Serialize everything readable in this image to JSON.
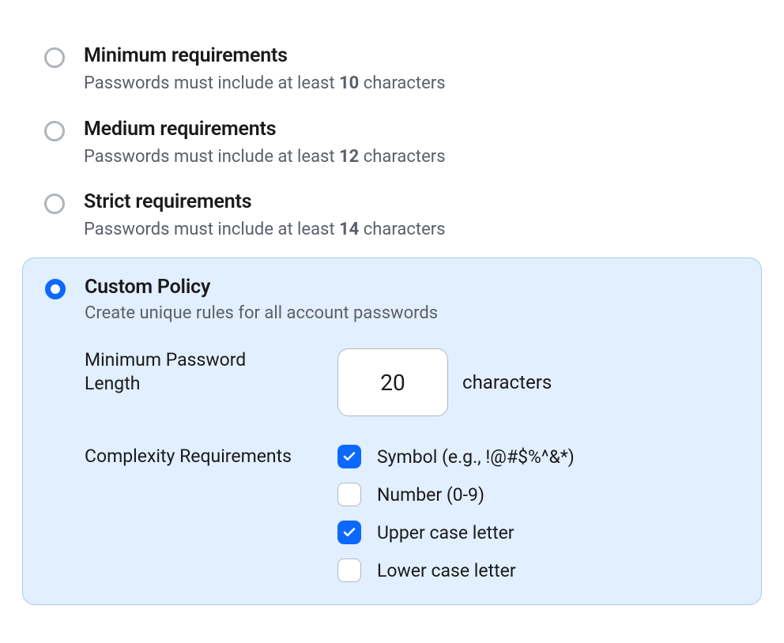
{
  "options": {
    "minimum": {
      "title": "Minimum requirements",
      "desc_prefix": "Passwords must include at least ",
      "count": "10",
      "desc_suffix": " characters",
      "selected": false
    },
    "medium": {
      "title": "Medium requirements",
      "desc_prefix": "Passwords must include at least ",
      "count": "12",
      "desc_suffix": " characters",
      "selected": false
    },
    "strict": {
      "title": "Strict requirements",
      "desc_prefix": "Passwords must include at least ",
      "count": "14",
      "desc_suffix": " characters",
      "selected": false
    },
    "custom": {
      "title": "Custom Policy",
      "desc": "Create unique rules for all account passwords",
      "selected": true
    }
  },
  "custom_form": {
    "min_length_label": "Minimum Password Length",
    "min_length_value": "20",
    "min_length_suffix": "characters",
    "complexity_label": "Complexity Requirements",
    "checks": {
      "symbol": {
        "label": "Symbol (e.g., !@#$%^&*)",
        "checked": true
      },
      "number": {
        "label": "Number (0-9)",
        "checked": false
      },
      "upper": {
        "label": "Upper case letter",
        "checked": true
      },
      "lower": {
        "label": "Lower case letter",
        "checked": false
      }
    }
  }
}
